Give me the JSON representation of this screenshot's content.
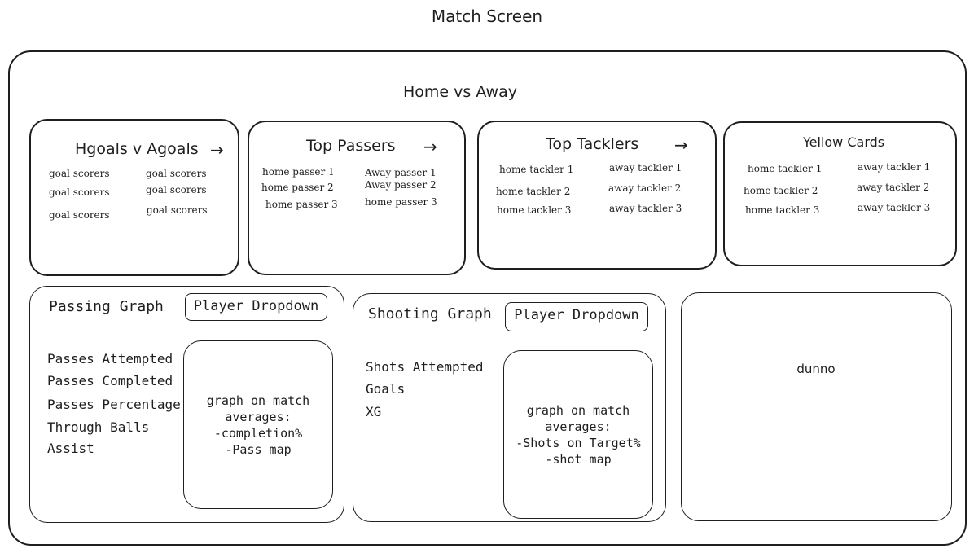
{
  "page_title": "Match Screen",
  "matchup": "Home vs Away",
  "score_card": {
    "title": "Hgoals v Agoals",
    "arrow": "→",
    "home_scorers": [
      "goal scorers",
      "goal scorers",
      "goal scorers"
    ],
    "away_scorers": [
      "goal scorers",
      "goal scorers",
      "goal scorers"
    ]
  },
  "passers_card": {
    "title": "Top Passers",
    "arrow": "→",
    "home": [
      "home passer 1",
      "home passer 2",
      "home passer 3"
    ],
    "away": [
      "Away passer 1",
      "Away passer 2",
      "home passer 3"
    ]
  },
  "tacklers_card": {
    "title": "Top Tacklers",
    "arrow": "→",
    "home": [
      "home tackler 1",
      "home tackler 2",
      "home tackler 3"
    ],
    "away": [
      "away tackler 1",
      "away tackler 2",
      "away tackler 3"
    ]
  },
  "yellow_card": {
    "title": "Yellow Cards",
    "home": [
      "home tackler 1",
      "home tackler 2",
      "home tackler 3"
    ],
    "away": [
      "away tackler 1",
      "away tackler 2",
      "away tackler 3"
    ]
  },
  "passing_panel": {
    "title": "Passing Graph",
    "dropdown": "Player Dropdown",
    "stats": [
      "Passes Attempted",
      "Passes Completed",
      "Passes Percentage",
      "Through Balls",
      "Assist"
    ],
    "graph_text": "graph on match\naverages:\n-completion%\n-Pass map"
  },
  "shooting_panel": {
    "title": "Shooting Graph",
    "dropdown": "Player Dropdown",
    "stats": [
      "Shots Attempted",
      "Goals",
      "XG"
    ],
    "graph_text": "graph on match\naverages:\n-Shots on Target%\n-shot map"
  },
  "misc_panel": {
    "label": "dunno"
  }
}
